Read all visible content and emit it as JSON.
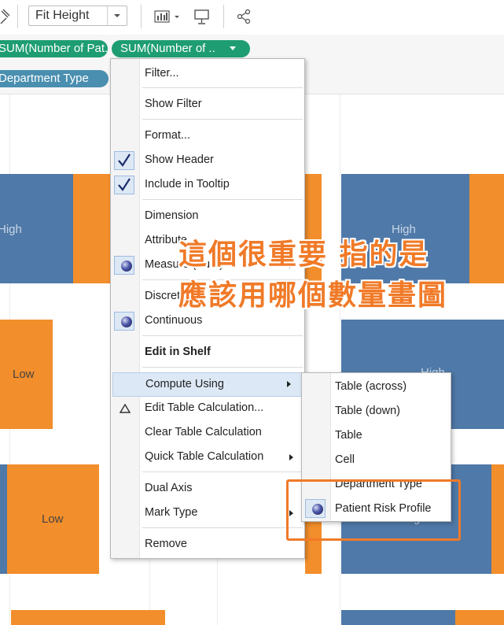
{
  "toolbar": {
    "fit_label": "Fit Height"
  },
  "shelves": {
    "pill1": "SUM(Number of Pat..",
    "pill2": "SUM(Number of ..",
    "pill3": "Department Type"
  },
  "viz": {
    "labels": {
      "high_left": "High",
      "high_right": "High",
      "low_1": "Low",
      "low_2": "Low",
      "high_right_2": "High",
      "high_right_3": "High"
    }
  },
  "menu": {
    "filter": "Filter...",
    "show_filter": "Show Filter",
    "format": "Format...",
    "show_header": "Show Header",
    "include_tooltip": "Include in Tooltip",
    "dimension": "Dimension",
    "attribute": "Attribute",
    "measure": "Measure (Sum)",
    "discrete": "Discrete",
    "continuous": "Continuous",
    "edit_in_shelf": "Edit in Shelf",
    "compute_using": "Compute Using",
    "edit_table_calc": "Edit Table Calculation...",
    "clear_table_calc": "Clear Table Calculation",
    "quick_table_calc": "Quick Table Calculation",
    "dual_axis": "Dual Axis",
    "mark_type": "Mark Type",
    "remove": "Remove"
  },
  "submenu": {
    "table_across": "Table (across)",
    "table_down": "Table (down)",
    "table": "Table",
    "cell": "Cell",
    "department_type": "Department Type",
    "patient_risk_profile": "Patient Risk Profile"
  },
  "annotation": {
    "line1": "這個很重要 指的是",
    "line2": "應該用哪個數量畫圖"
  },
  "colors": {
    "blue": "#4f79a8",
    "orange": "#f28e2b",
    "pill_green": "#1e9d73",
    "pill_blue": "#4a8fb0",
    "annotation": "#f07a28"
  }
}
